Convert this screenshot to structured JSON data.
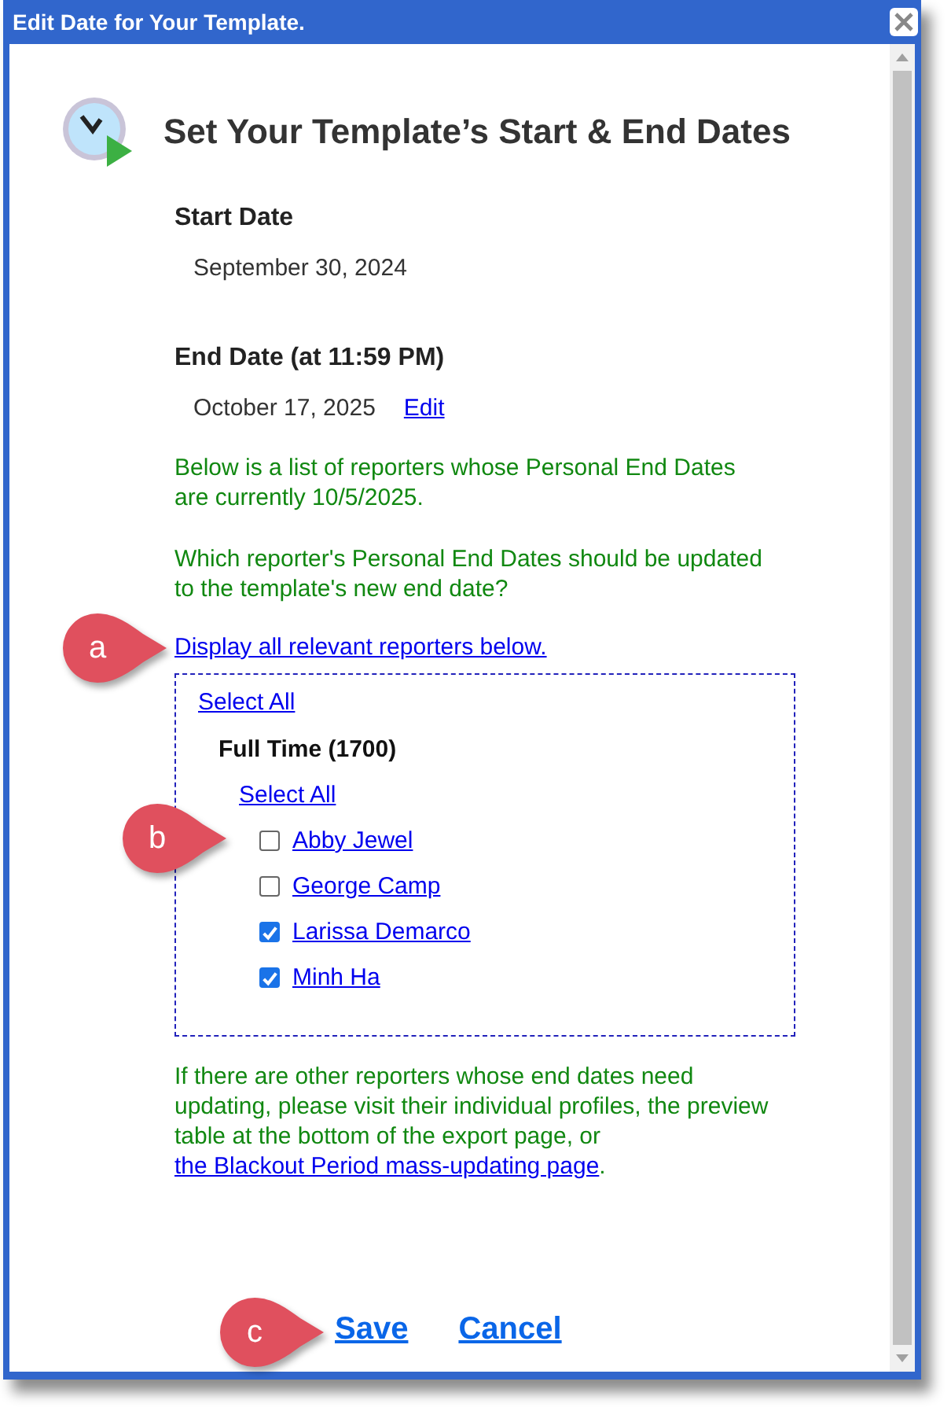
{
  "window": {
    "title": "Edit Date for Your Template."
  },
  "heading": "Set Your Template’s Start & End Dates",
  "start_date": {
    "label": "Start Date",
    "value": "September 30, 2024"
  },
  "end_date": {
    "label": "End Date (at 11:59 PM)",
    "value": "October 17, 2025",
    "edit_link": "Edit"
  },
  "notes": [
    "Below is a list of reporters whose Personal End Dates are currently 10/5/2025.",
    "Which reporter's Personal End Dates should be updated to the template's new end date?"
  ],
  "display_link": {
    "text": "Display all relevant reporters below.",
    "callout": "a"
  },
  "reporter_box": {
    "select_all": "Select All",
    "groups": [
      {
        "name": "Full Time (1700)",
        "select_all": "Select All",
        "reporters": [
          {
            "name": "Abby Jewel",
            "checked": false,
            "callout": "b"
          },
          {
            "name": "George Camp",
            "checked": false
          },
          {
            "name": "Larissa Demarco",
            "checked": true
          },
          {
            "name": "Minh Ha",
            "checked": true
          }
        ]
      }
    ]
  },
  "footer_note": {
    "text": "If there are other reporters whose end dates need updating, please visit their individual profiles, the preview table at the bottom of the export page, or ",
    "link": "the Blackout Period mass-updating page",
    "after": "."
  },
  "buttons": {
    "labels": [
      "Save",
      "Cancel"
    ],
    "callout": "c"
  }
}
